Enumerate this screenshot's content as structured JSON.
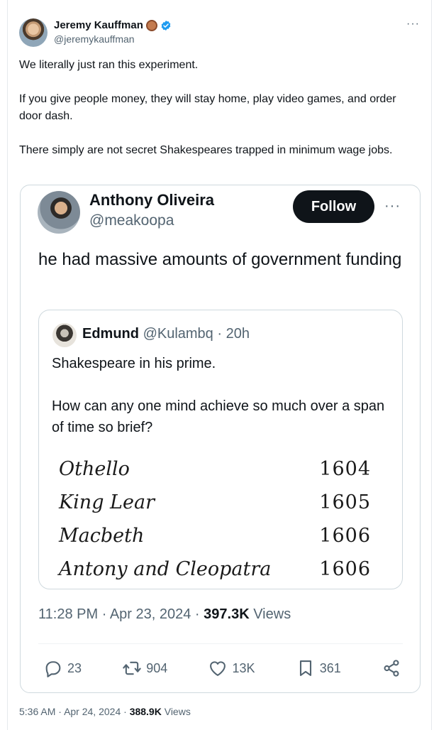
{
  "outer": {
    "author_name": "Jeremy Kauffman",
    "author_handle": "@jeremykauffman",
    "more_label": "···",
    "paragraphs": [
      "We literally just ran this experiment.",
      "If you give people money, they will stay home, play video games, and order door dash.",
      "There simply are not secret Shakespeares trapped in minimum wage jobs."
    ],
    "time": "5:36 AM",
    "date": "Apr 24, 2024",
    "views_count": "388.9K",
    "views_label": "Views"
  },
  "embed": {
    "author_name": "Anthony Oliveira",
    "author_handle": "@meakoopa",
    "follow_label": "Follow",
    "more_label": "···",
    "text": "he had massive amounts of government funding",
    "time": "11:28 PM",
    "date": "Apr 23, 2024",
    "views_count": "397.3K",
    "views_label": "Views",
    "actions": {
      "replies": "23",
      "reposts": "904",
      "likes": "13K",
      "bookmarks": "361"
    }
  },
  "quote": {
    "author_name": "Edmund",
    "author_handle": "@Kulambq",
    "age": "20h",
    "paragraphs": [
      "Shakespeare in his prime.",
      "How can any one mind achieve so much over a span of time so brief?"
    ],
    "plays": [
      {
        "title": "Othello",
        "year": "1604"
      },
      {
        "title": "King Lear",
        "year": "1605"
      },
      {
        "title": "Macbeth",
        "year": "1606"
      },
      {
        "title": "Antony and Cleopatra",
        "year": "1606"
      }
    ]
  },
  "colors": {
    "text": "#0f1419",
    "secondary": "#536471",
    "border": "#cfd9de",
    "verified": "#1d9bf0",
    "follow_bg": "#0f1419"
  }
}
